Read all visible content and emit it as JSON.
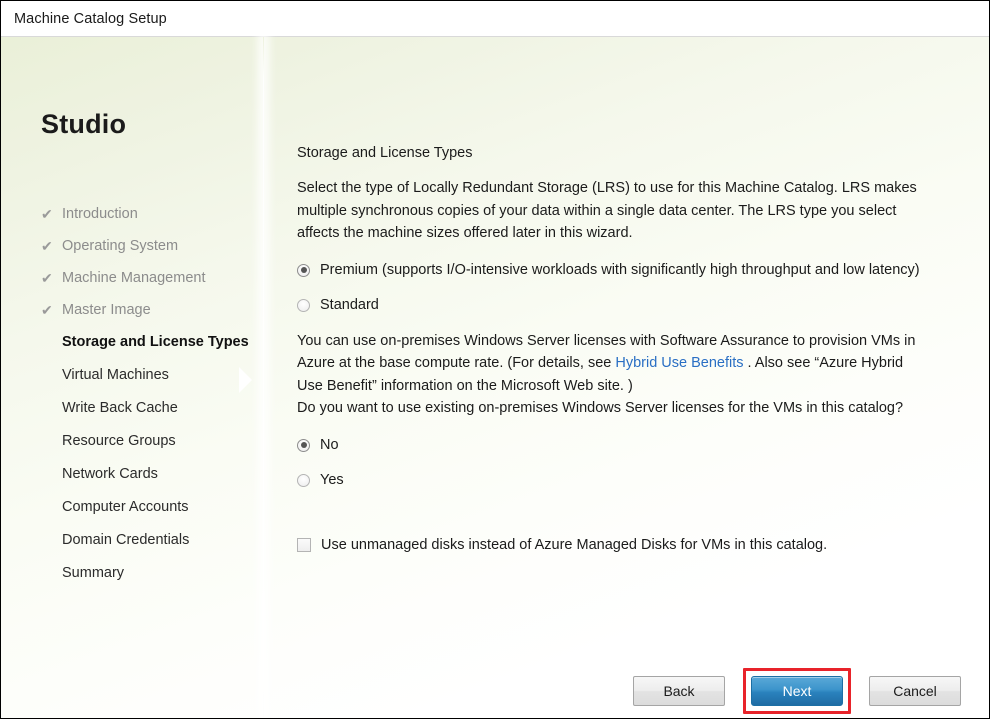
{
  "window": {
    "title": "Machine Catalog Setup"
  },
  "nav": {
    "brand": "Studio",
    "check_glyph": "✔",
    "items": [
      {
        "label": "Introduction",
        "state": "done"
      },
      {
        "label": "Operating System",
        "state": "done"
      },
      {
        "label": "Machine Management",
        "state": "done"
      },
      {
        "label": "Master Image",
        "state": "done"
      },
      {
        "label": "Storage and License Types",
        "state": "active"
      },
      {
        "label": "Virtual Machines",
        "state": "pending"
      },
      {
        "label": "Write Back Cache",
        "state": "pending"
      },
      {
        "label": "Resource Groups",
        "state": "pending"
      },
      {
        "label": "Network Cards",
        "state": "pending"
      },
      {
        "label": "Computer Accounts",
        "state": "pending"
      },
      {
        "label": "Domain Credentials",
        "state": "pending"
      },
      {
        "label": "Summary",
        "state": "pending"
      }
    ]
  },
  "content": {
    "section_title": "Storage and License Types",
    "description": "Select the type of Locally Redundant Storage (LRS) to use for this Machine Catalog. LRS makes multiple synchronous copies of your data within a single data center. The LRS type you select affects the machine sizes offered later in this wizard.",
    "storage_options": [
      {
        "label": "Premium (supports I/O-intensive workloads with significantly high throughput and low latency)",
        "selected": true
      },
      {
        "label": "Standard",
        "selected": false
      }
    ],
    "license_text_part1": "You can use on-premises Windows Server licenses with Software Assurance to provision VMs in Azure at the base compute rate. (For details, see ",
    "license_link": "Hybrid Use Benefits",
    "license_text_part2": " . Also see “Azure Hybrid Use Benefit” information on the Microsoft Web site. )",
    "license_question": "Do you want to use existing on-premises Windows Server licenses for the VMs in this catalog?",
    "license_options": [
      {
        "label": "No",
        "selected": true
      },
      {
        "label": "Yes",
        "selected": false
      }
    ],
    "unmanaged_disks_checkbox": {
      "label": "Use unmanaged disks instead of Azure Managed Disks for VMs in this catalog.",
      "checked": false
    }
  },
  "footer": {
    "back_label": "Back",
    "next_label": "Next",
    "cancel_label": "Cancel"
  },
  "colors": {
    "link": "#2a6fc4",
    "primary_button": "#2a82bd",
    "highlight_box": "#e8232a",
    "background_tint": "#eaf0d8"
  }
}
